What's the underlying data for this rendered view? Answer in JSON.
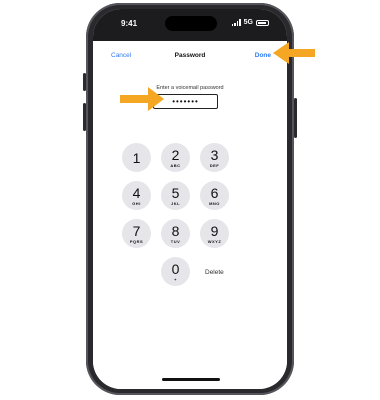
{
  "status_bar": {
    "time": "9:41",
    "network": "5G"
  },
  "nav": {
    "cancel_label": "Cancel",
    "title": "Password",
    "done_label": "Done"
  },
  "password": {
    "prompt": "Enter a voicemail password",
    "value": "•••••••"
  },
  "keypad": {
    "keys": [
      {
        "digit": "1",
        "letters": ""
      },
      {
        "digit": "2",
        "letters": "ABC"
      },
      {
        "digit": "3",
        "letters": "DEF"
      },
      {
        "digit": "4",
        "letters": "GHI"
      },
      {
        "digit": "5",
        "letters": "JKL"
      },
      {
        "digit": "6",
        "letters": "MNO"
      },
      {
        "digit": "7",
        "letters": "PQRS"
      },
      {
        "digit": "8",
        "letters": "TUV"
      },
      {
        "digit": "9",
        "letters": "WXYZ"
      },
      {
        "digit": "0",
        "letters": "+"
      }
    ],
    "delete_label": "Delete"
  },
  "colors": {
    "accent": "#2e7cf6",
    "arrow": "#f5a623",
    "key_bg": "#e5e5ea",
    "frame": "#2a2a2e"
  },
  "icons": [
    "signal-icon",
    "battery-icon",
    "pointer-arrow-icon"
  ]
}
